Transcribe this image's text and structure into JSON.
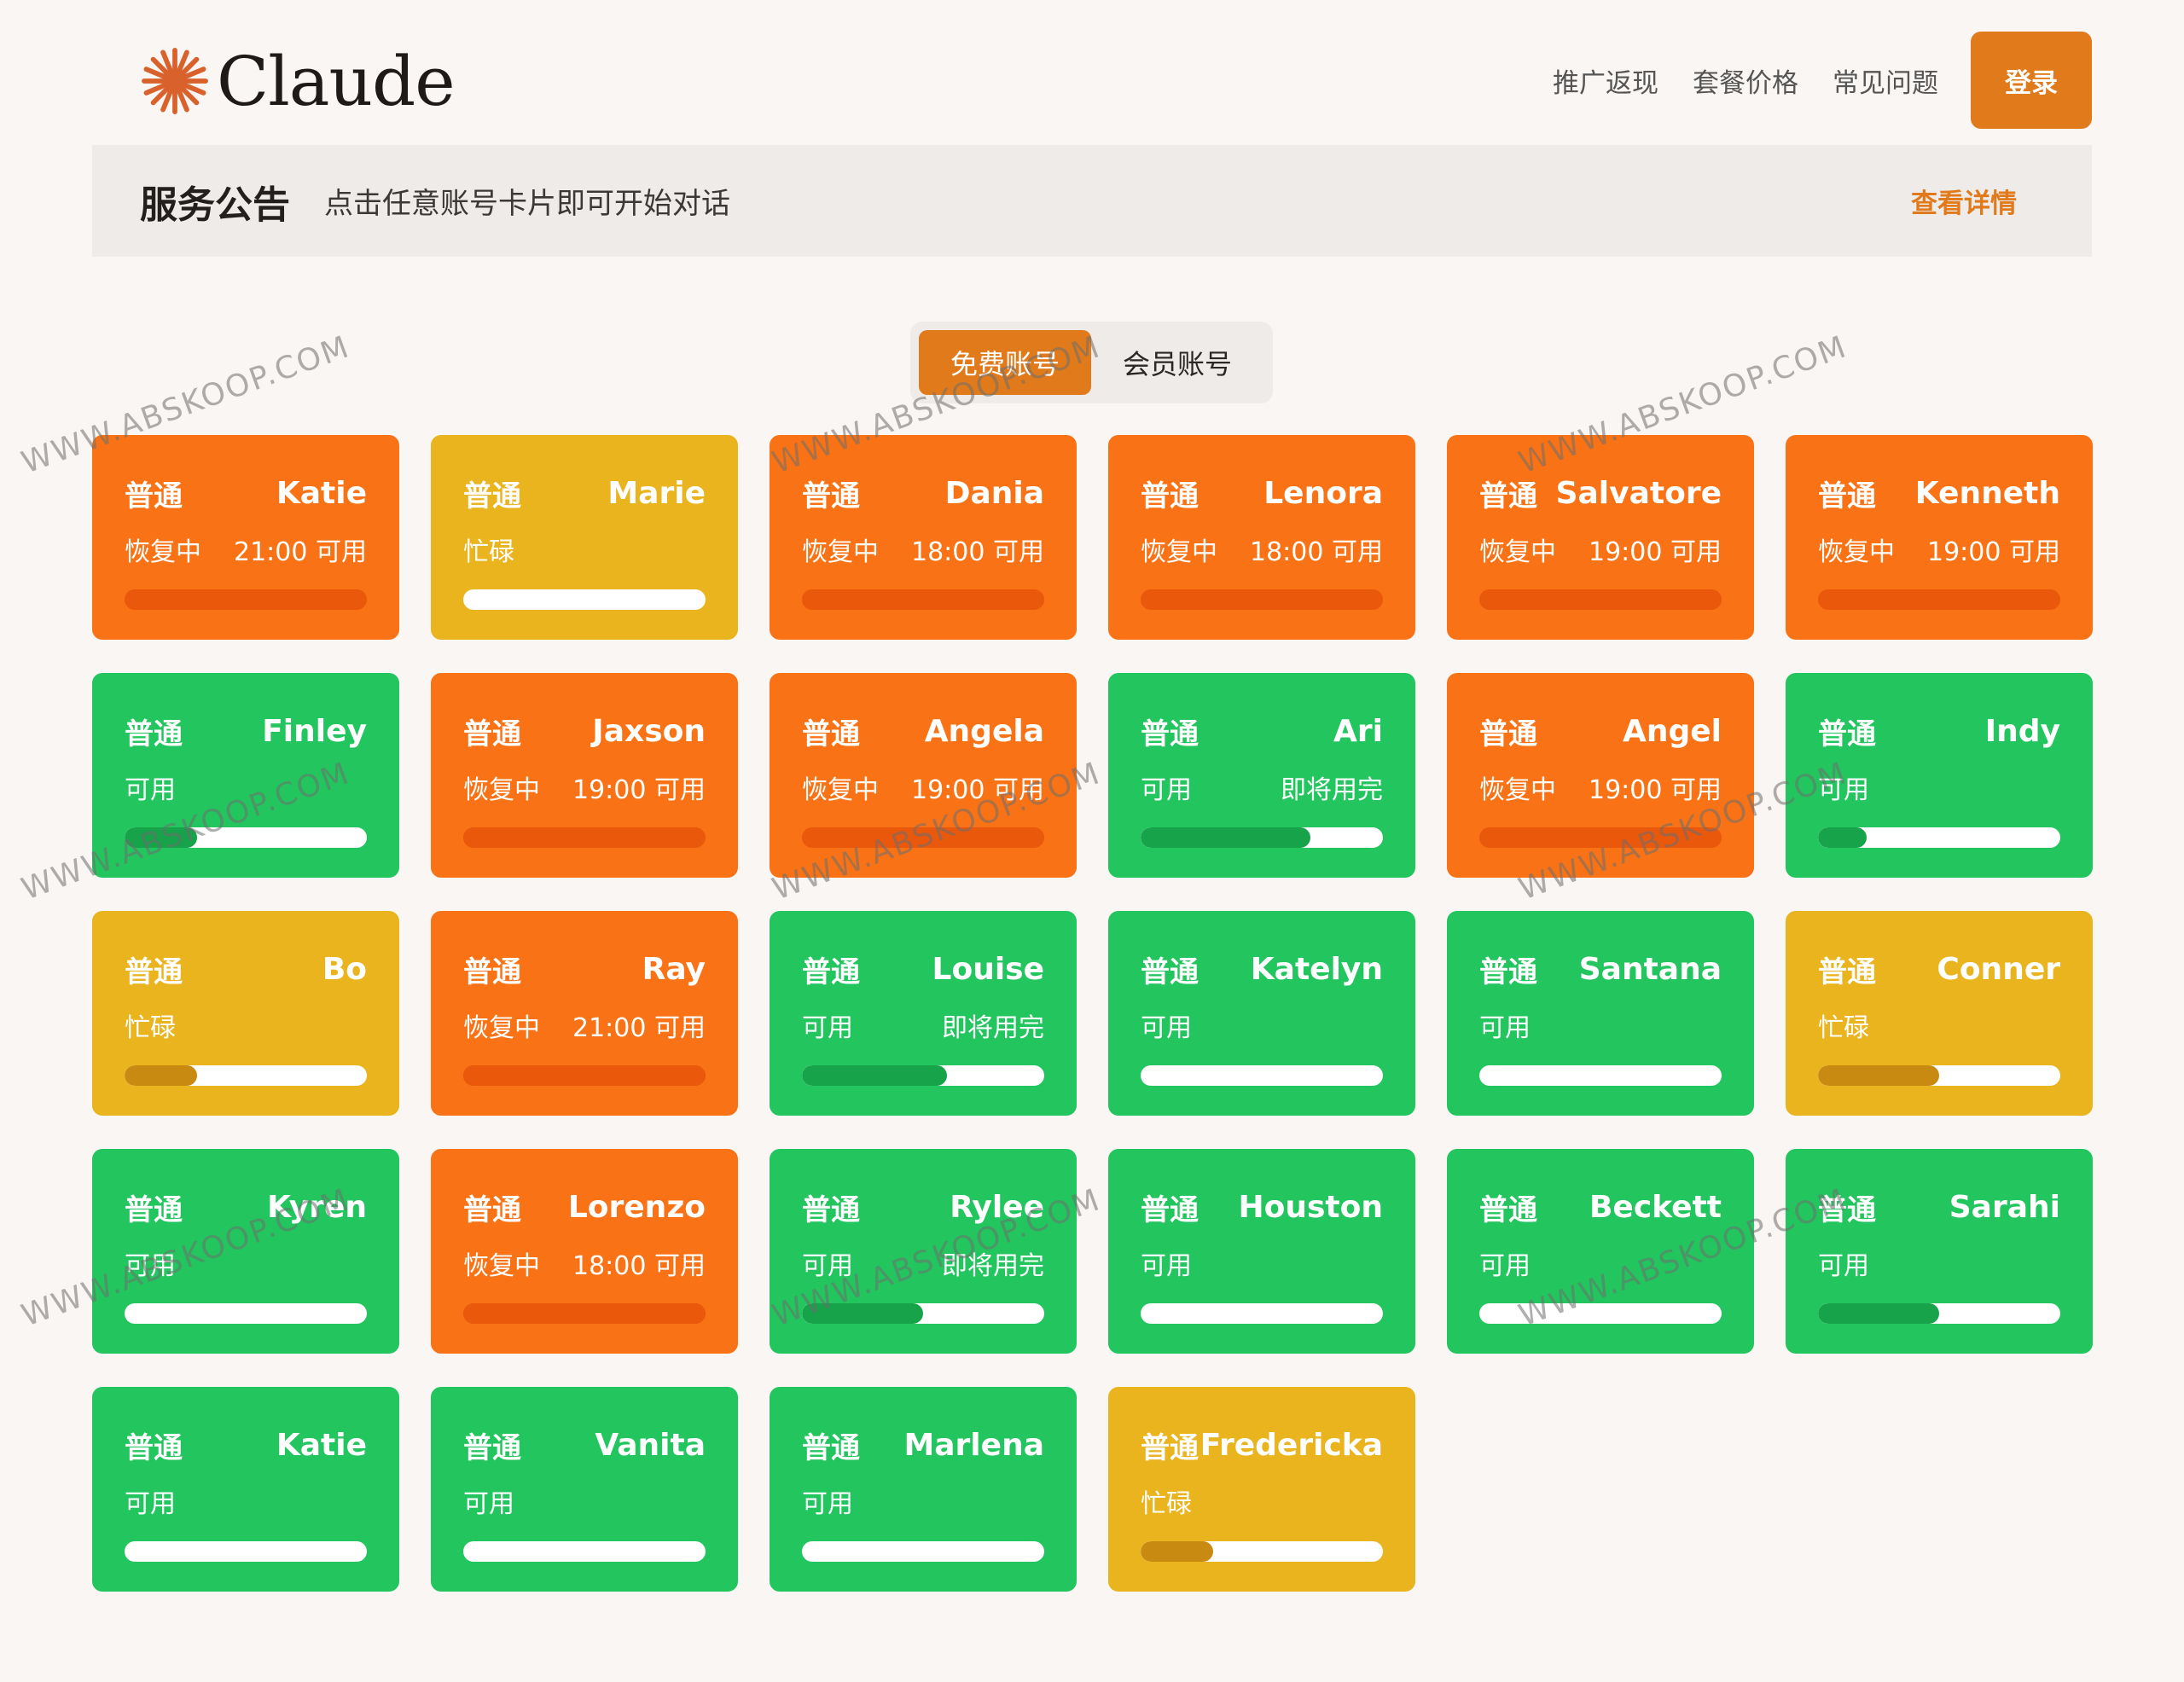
{
  "brand": {
    "name": "Claude",
    "accent": "#e07a1b"
  },
  "nav": {
    "links": [
      "推广返现",
      "套餐价格",
      "常见问题"
    ],
    "login_label": "登录"
  },
  "announcement": {
    "title": "服务公告",
    "text": "点击任意账号卡片即可开始对话",
    "link": "查看详情"
  },
  "tabs": [
    {
      "label": "免费账号",
      "active": true
    },
    {
      "label": "会员账号",
      "active": false
    }
  ],
  "status_colors": {
    "recovering": "#f97316",
    "busy": "#eab41f",
    "available": "#22c55e"
  },
  "cards": [
    {
      "tier": "普通",
      "name": "Katie",
      "status": "恢复中",
      "note": "21:00 可用",
      "state": "recovering",
      "usage": 1
    },
    {
      "tier": "普通",
      "name": "Marie",
      "status": "忙碌",
      "note": "",
      "state": "busy",
      "usage": 0
    },
    {
      "tier": "普通",
      "name": "Dania",
      "status": "恢复中",
      "note": "18:00 可用",
      "state": "recovering",
      "usage": 1
    },
    {
      "tier": "普通",
      "name": "Lenora",
      "status": "恢复中",
      "note": "18:00 可用",
      "state": "recovering",
      "usage": 1
    },
    {
      "tier": "普通",
      "name": "Salvatore",
      "status": "恢复中",
      "note": "19:00 可用",
      "state": "recovering",
      "usage": 1
    },
    {
      "tier": "普通",
      "name": "Kenneth",
      "status": "恢复中",
      "note": "19:00 可用",
      "state": "recovering",
      "usage": 1
    },
    {
      "tier": "普通",
      "name": "Finley",
      "status": "可用",
      "note": "",
      "state": "available",
      "usage": 0.3
    },
    {
      "tier": "普通",
      "name": "Jaxson",
      "status": "恢复中",
      "note": "19:00 可用",
      "state": "recovering",
      "usage": 1
    },
    {
      "tier": "普通",
      "name": "Angela",
      "status": "恢复中",
      "note": "19:00 可用",
      "state": "recovering",
      "usage": 1
    },
    {
      "tier": "普通",
      "name": "Ari",
      "status": "可用",
      "note": "即将用完",
      "state": "available",
      "usage": 0.7
    },
    {
      "tier": "普通",
      "name": "Angel",
      "status": "恢复中",
      "note": "19:00 可用",
      "state": "recovering",
      "usage": 1
    },
    {
      "tier": "普通",
      "name": "Indy",
      "status": "可用",
      "note": "",
      "state": "available",
      "usage": 0.2
    },
    {
      "tier": "普通",
      "name": "Bo",
      "status": "忙碌",
      "note": "",
      "state": "busy",
      "usage": 0.3
    },
    {
      "tier": "普通",
      "name": "Ray",
      "status": "恢复中",
      "note": "21:00 可用",
      "state": "recovering",
      "usage": 1
    },
    {
      "tier": "普通",
      "name": "Louise",
      "status": "可用",
      "note": "即将用完",
      "state": "available",
      "usage": 0.6
    },
    {
      "tier": "普通",
      "name": "Katelyn",
      "status": "可用",
      "note": "",
      "state": "available",
      "usage": 0
    },
    {
      "tier": "普通",
      "name": "Santana",
      "status": "可用",
      "note": "",
      "state": "available",
      "usage": 0
    },
    {
      "tier": "普通",
      "name": "Conner",
      "status": "忙碌",
      "note": "",
      "state": "busy",
      "usage": 0.5
    },
    {
      "tier": "普通",
      "name": "Kyren",
      "status": "可用",
      "note": "",
      "state": "available",
      "usage": 0
    },
    {
      "tier": "普通",
      "name": "Lorenzo",
      "status": "恢复中",
      "note": "18:00 可用",
      "state": "recovering",
      "usage": 1
    },
    {
      "tier": "普通",
      "name": "Rylee",
      "status": "可用",
      "note": "即将用完",
      "state": "available",
      "usage": 0.5
    },
    {
      "tier": "普通",
      "name": "Houston",
      "status": "可用",
      "note": "",
      "state": "available",
      "usage": 0
    },
    {
      "tier": "普通",
      "name": "Beckett",
      "status": "可用",
      "note": "",
      "state": "available",
      "usage": 0
    },
    {
      "tier": "普通",
      "name": "Sarahi",
      "status": "可用",
      "note": "",
      "state": "available",
      "usage": 0.5
    },
    {
      "tier": "普通",
      "name": "Katie",
      "status": "可用",
      "note": "",
      "state": "available",
      "usage": 0
    },
    {
      "tier": "普通",
      "name": "Vanita",
      "status": "可用",
      "note": "",
      "state": "available",
      "usage": 0
    },
    {
      "tier": "普通",
      "name": "Marlena",
      "status": "可用",
      "note": "",
      "state": "available",
      "usage": 0
    },
    {
      "tier": "普通",
      "name": "Fredericka",
      "status": "忙碌",
      "note": "",
      "state": "busy",
      "usage": 0.3
    }
  ],
  "watermark": "WWW.ABSKOOP.COM"
}
